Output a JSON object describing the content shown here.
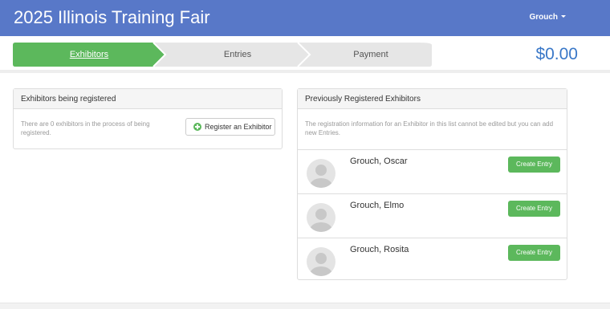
{
  "header": {
    "title": "2025 Illinois Training Fair",
    "user_label": "Grouch"
  },
  "steps": [
    {
      "label": "Exhibitors",
      "active": true
    },
    {
      "label": "Entries",
      "active": false
    },
    {
      "label": "Payment",
      "active": false
    }
  ],
  "total": "$0.00",
  "colors": {
    "header": "#5878c8",
    "active_step": "#5cb85c",
    "inactive_step": "#e6e6e6",
    "total": "#3a78c8",
    "button": "#5cb85c"
  },
  "left_panel": {
    "title": "Exhibitors being registered",
    "text": "There are 0 exhibitors in the process of being registered.",
    "button_label": "Register an Exhibitor",
    "button_icon": "plus-circle-icon"
  },
  "right_panel": {
    "title": "Previously Registered Exhibitors",
    "note": "The registration information for an Exhibitor in this list cannot be edited but you can add new Entries.",
    "exhibitors": [
      {
        "name": "Grouch, Oscar",
        "button": "Create Entry"
      },
      {
        "name": "Grouch, Elmo",
        "button": "Create Entry"
      },
      {
        "name": "Grouch, Rosita",
        "button": "Create Entry"
      }
    ]
  }
}
